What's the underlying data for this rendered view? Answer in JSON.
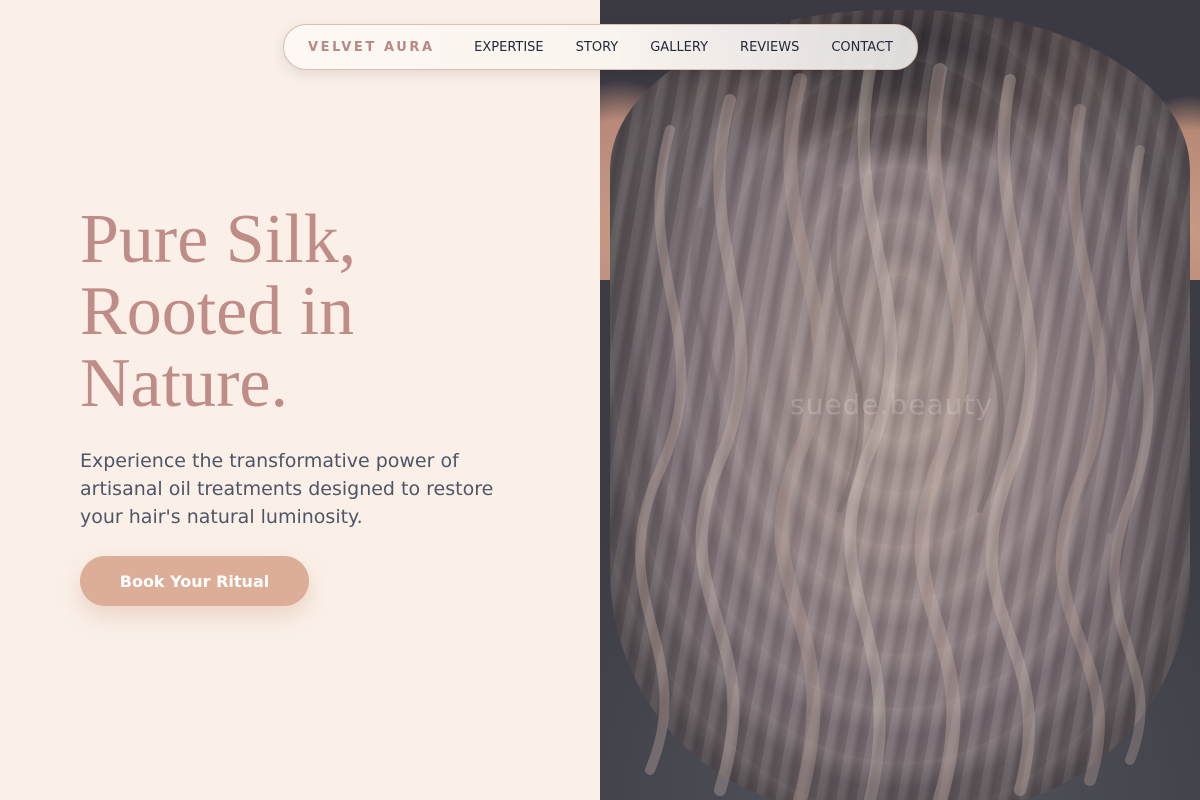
{
  "nav": {
    "brand": "VELVET AURA",
    "links": [
      "EXPERTISE",
      "STORY",
      "GALLERY",
      "REVIEWS",
      "CONTACT"
    ]
  },
  "hero": {
    "title_lines": [
      "Pure Silk,",
      "Rooted in",
      "Nature."
    ],
    "subtitle": "Experience the transformative power of artisanal oil treatments designed to restore your hair's natural luminosity.",
    "cta_label": "Book Your Ritual"
  },
  "photo": {
    "watermark": "suede.beauty"
  },
  "colors": {
    "background": "#faf0e8",
    "accent": "#bf8c88",
    "button": "#dcae97",
    "text": "#4d5566"
  }
}
